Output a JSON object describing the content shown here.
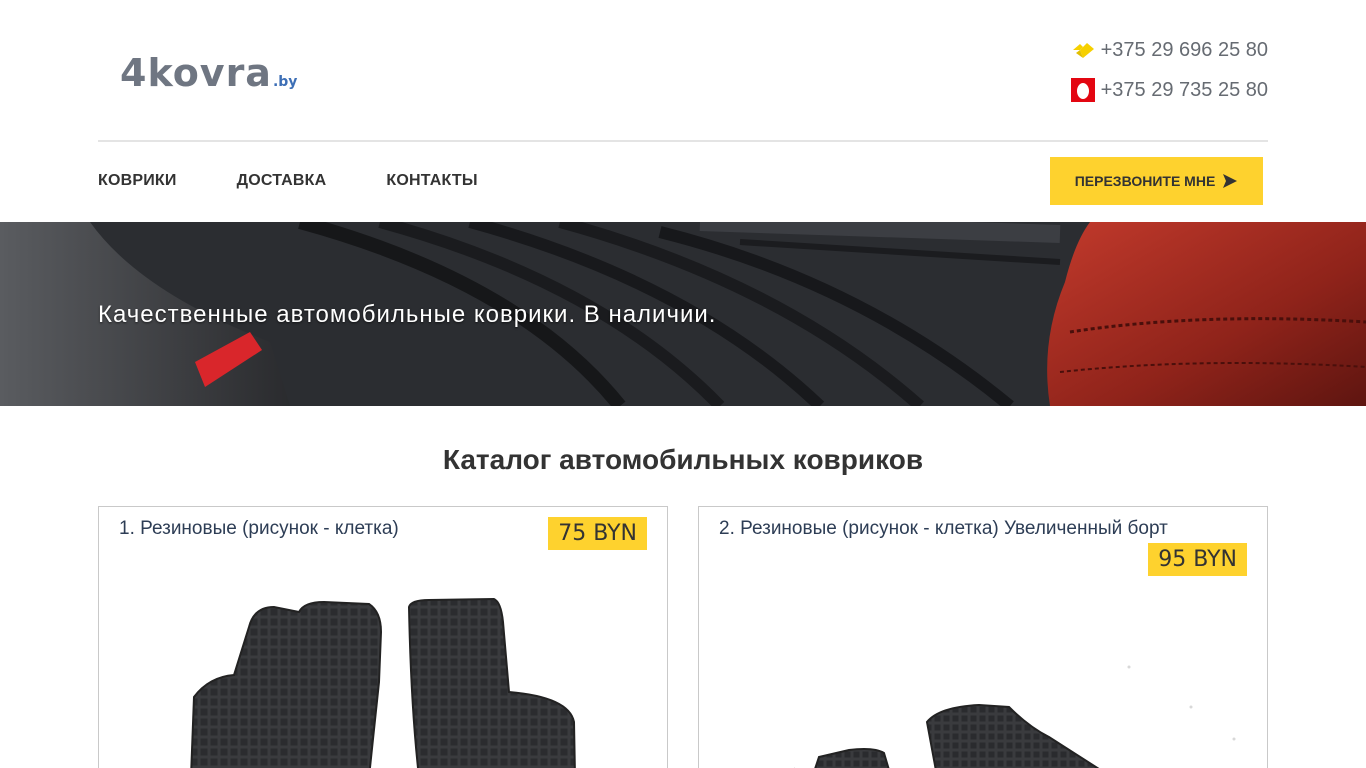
{
  "header": {
    "logo_main": "4kovra",
    "logo_sub": ".by",
    "phones": [
      {
        "operator_icon": "life-operator-icon",
        "number": "+375 29 696 25 80"
      },
      {
        "operator_icon": "mts-operator-icon",
        "number": "+375 29 735 25 80"
      }
    ]
  },
  "nav": {
    "items": [
      {
        "label": "КОВРИКИ"
      },
      {
        "label": "ДОСТАВКА"
      },
      {
        "label": "КОНТАКТЫ"
      }
    ],
    "callback_label": "ПЕРЕЗВОНИТЕ МНЕ"
  },
  "hero": {
    "tagline": "Качественные автомобильные коврики. В наличии."
  },
  "catalog": {
    "title_bold": "Каталог",
    "title_rest": " автомобильных ковриков",
    "products": [
      {
        "name": "1. Резиновые (рисунок - клетка)",
        "price": "75 BYN"
      },
      {
        "name": "2. Резиновые (рисунок - клетка) Увеличенный борт",
        "price": "95 BYN"
      }
    ]
  },
  "colors": {
    "accent_yellow": "#fed22e",
    "text_dark": "#333333",
    "product_title": "#2d3d55",
    "life_yellow": "#f6d000",
    "mts_red": "#e30611"
  }
}
